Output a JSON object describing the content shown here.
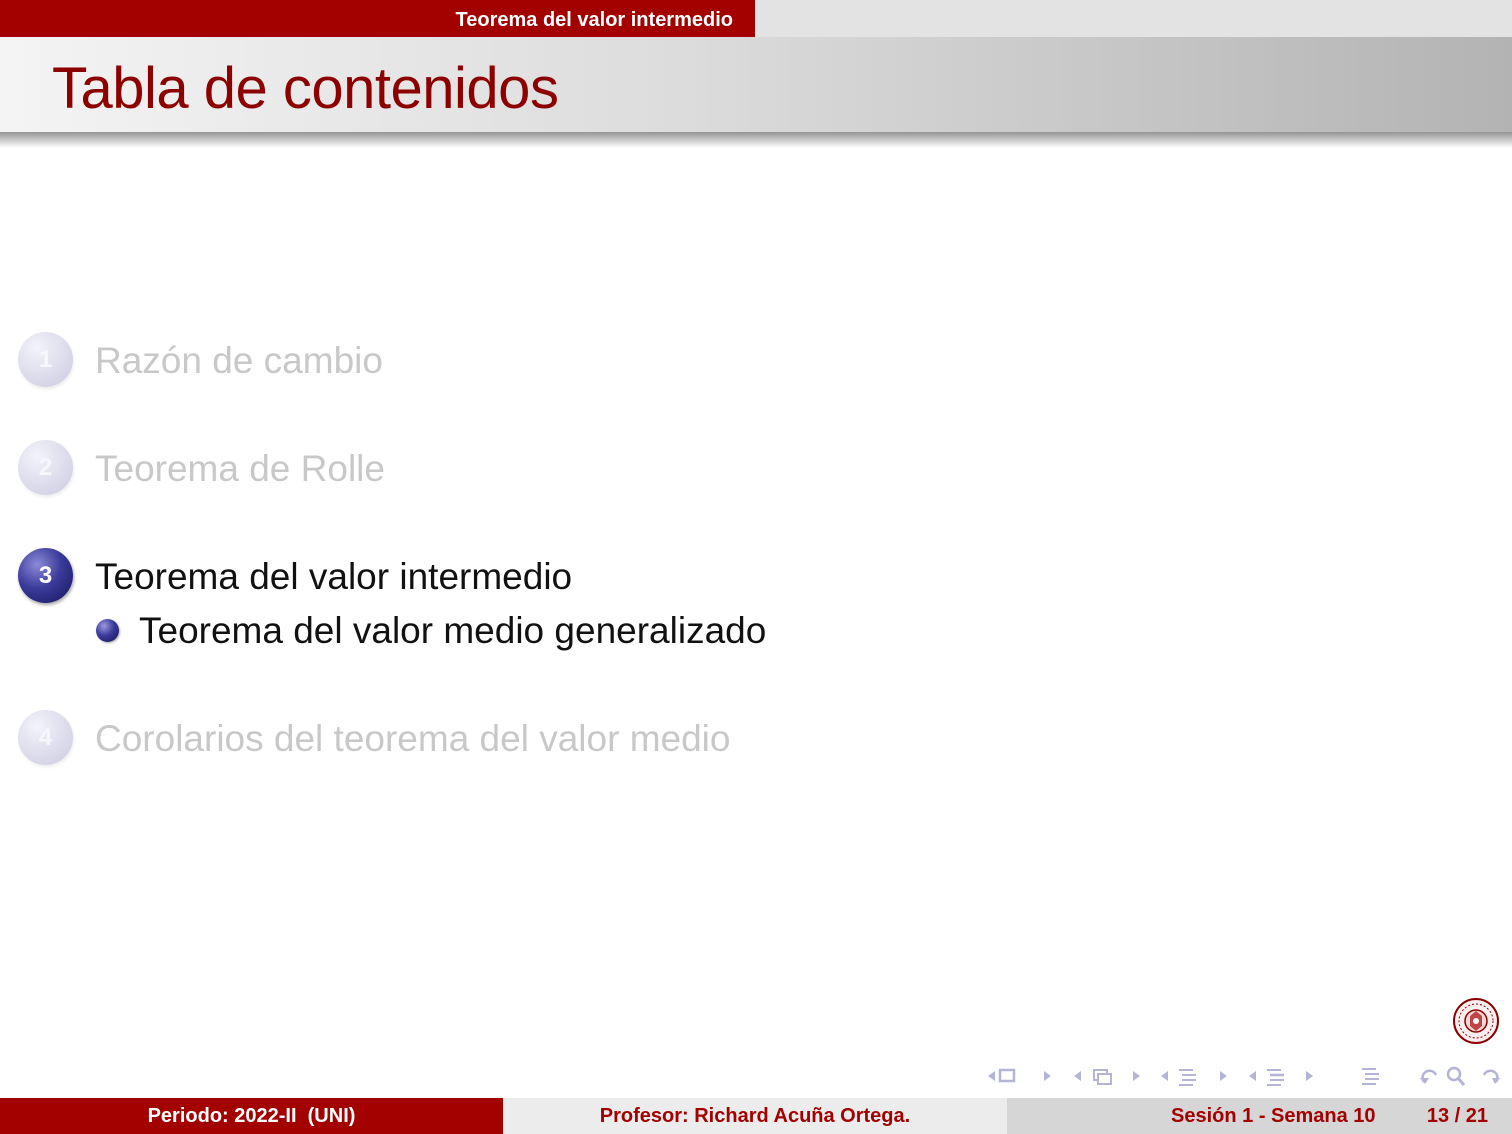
{
  "header": {
    "section_title": "Teorema del valor intermedio"
  },
  "frame": {
    "title": "Tabla de contenidos"
  },
  "toc": {
    "items": [
      {
        "number": "1",
        "label": "Razón de cambio",
        "state": "dimmed"
      },
      {
        "number": "2",
        "label": "Teorema de Rolle",
        "state": "dimmed"
      },
      {
        "number": "3",
        "label": "Teorema del valor intermedio",
        "state": "active"
      },
      {
        "number": "4",
        "label": "Corolarios del teorema del valor medio",
        "state": "dimmed"
      }
    ],
    "subitems": [
      {
        "label": "Teorema del valor medio generalizado"
      }
    ]
  },
  "logo": {
    "icon": "university-seal-icon"
  },
  "navigation": {
    "icons": [
      "nav-slide-icon",
      "nav-frame-icon",
      "nav-subsection-icon",
      "nav-section-icon",
      "nav-document-icon",
      "nav-back-icon",
      "nav-search-icon",
      "nav-forward-icon"
    ]
  },
  "footer": {
    "period": "Periodo: 2022-II  (UNI)",
    "professor": "Profesor: Richard Acuña Ortega.",
    "session": "Sesión 1 - Semana 10",
    "page": "13 / 21"
  },
  "colors": {
    "accent": "#a30000",
    "title_text": "#8c0000",
    "ball_active": "#2e2e8c",
    "dimmed_text": "#c8c8c8"
  }
}
